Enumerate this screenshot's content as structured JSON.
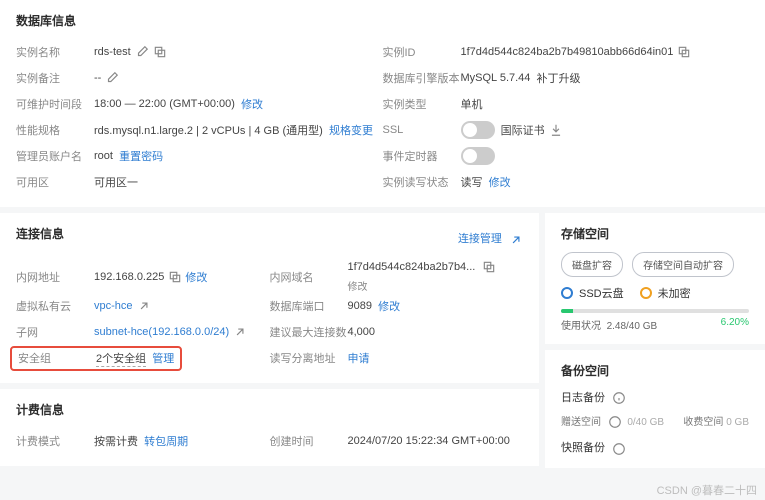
{
  "db": {
    "title": "数据库信息",
    "name_l": "实例名称",
    "name_v": "rds-test",
    "id_l": "实例ID",
    "id_v": "1f7d4d544c824ba2b7b49810abb66d64in01",
    "remark_l": "实例备注",
    "remark_v": "--",
    "engine_l": "数据库引擎版本",
    "engine_v": "MySQL 5.7.44",
    "engine_upg": "补丁升级",
    "maint_l": "可维护时间段",
    "maint_v": "18:00 — 22:00 (GMT+00:00)",
    "maint_edit": "修改",
    "type_l": "实例类型",
    "type_v": "单机",
    "spec_l": "性能规格",
    "spec_v": "rds.mysql.n1.large.2 | 2 vCPUs | 4 GB (通用型)",
    "spec_edit": "规格变更",
    "ssl_l": "SSL",
    "ssl_link": "国际证书",
    "admin_l": "管理员账户名",
    "admin_v": "root",
    "admin_reset": "重置密码",
    "timer_l": "事件定时器",
    "az_l": "可用区",
    "az_v": "可用区一",
    "rw_l": "实例读写状态",
    "rw_v": "读写",
    "rw_edit": "修改"
  },
  "conn": {
    "title": "连接信息",
    "manage": "连接管理",
    "ip_l": "内网地址",
    "ip_v": "192.168.0.225",
    "ip_edit": "修改",
    "dom_l": "内网域名",
    "dom_v": "1f7d4d544c824ba2b7b4...",
    "dom_edit": "修改",
    "vpc_l": "虚拟私有云",
    "vpc_v": "vpc-hce",
    "port_l": "数据库端口",
    "port_v": "9089",
    "port_edit": "修改",
    "subnet_l": "子网",
    "subnet_v": "subnet-hce(192.168.0.0/24)",
    "maxconn_l": "建议最大连接数",
    "maxconn_v": "4,000",
    "sg_l": "安全组",
    "sg_v": "2个安全组",
    "sg_mgr": "管理",
    "rwsep_l": "读写分离地址",
    "rwsep_v": "申请"
  },
  "bill": {
    "title": "计费信息",
    "mode_l": "计费模式",
    "mode_v": "按需计费",
    "mode_sw": "转包周期",
    "created_l": "创建时间",
    "created_v": "2024/07/20 15:22:34 GMT+00:00"
  },
  "storage": {
    "title": "存储空间",
    "btn1": "磁盘扩容",
    "btn2": "存储空间自动扩容",
    "disk": "SSD云盘",
    "enc": "未加密",
    "use_l": "使用状况",
    "use_v": "2.48/40 GB",
    "use_pct": "6.20%"
  },
  "backup": {
    "title": "备份空间",
    "log": "日志备份",
    "free_l": "赠送空间",
    "free_v": "0/40 GB",
    "paid_l": "收费空间",
    "paid_v": "0 GB",
    "fast": "快照备份"
  },
  "watermark": "CSDN @暮春二十四",
  "icons": {
    "dl": "↓"
  }
}
